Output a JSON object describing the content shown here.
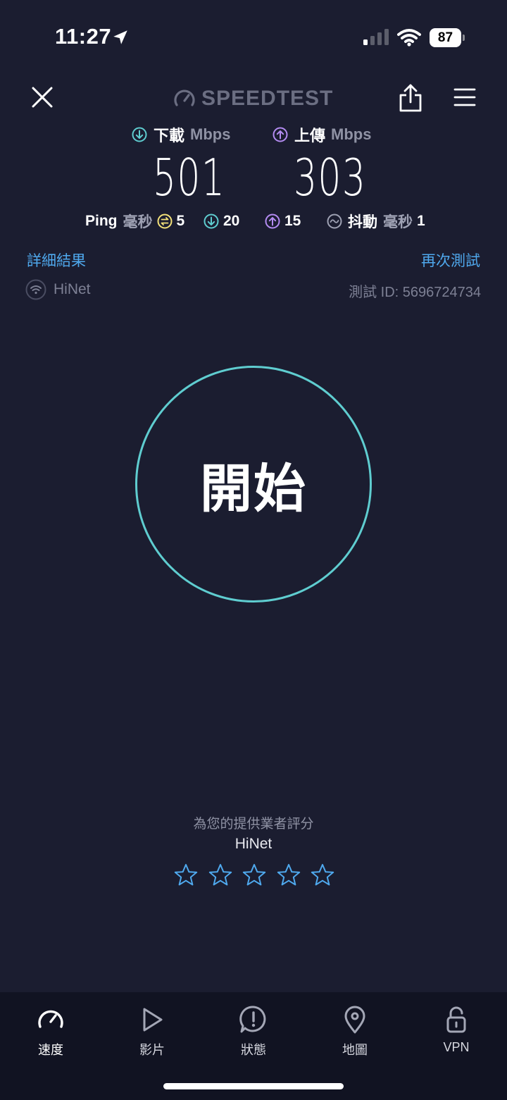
{
  "status_bar": {
    "time": "11:27",
    "battery": "87"
  },
  "header": {
    "logo_text": "SPEEDTEST"
  },
  "download": {
    "label": "下載",
    "unit": "Mbps",
    "value": "501"
  },
  "upload": {
    "label": "上傳",
    "unit": "Mbps",
    "value": "303"
  },
  "ping": {
    "label": "Ping",
    "unit": "毫秒",
    "idle": "5",
    "download": "20",
    "upload": "15",
    "jitter_label": "抖動",
    "jitter_unit": "毫秒",
    "jitter": "1"
  },
  "links": {
    "details": "詳細結果",
    "retest": "再次測試"
  },
  "provider": {
    "name": "HiNet",
    "test_id": "測試 ID: 5696724734"
  },
  "go_button": {
    "label": "開始"
  },
  "rating": {
    "title": "為您的提供業者評分",
    "isp": "HiNet",
    "stars": 5
  },
  "tabs": [
    {
      "label": "速度",
      "icon": "speedometer-icon",
      "active": true
    },
    {
      "label": "影片",
      "icon": "play-icon",
      "active": false
    },
    {
      "label": "狀態",
      "icon": "alert-icon",
      "active": false
    },
    {
      "label": "地圖",
      "icon": "map-pin-icon",
      "active": false
    },
    {
      "label": "VPN",
      "icon": "unlock-icon",
      "active": false
    }
  ],
  "colors": {
    "background": "#1b1d30",
    "download_accent": "#5fcdd0",
    "upload_accent": "#b48cf2",
    "idle_accent": "#f4e27a",
    "link": "#4fa9ee",
    "tabbar": "#111322"
  }
}
